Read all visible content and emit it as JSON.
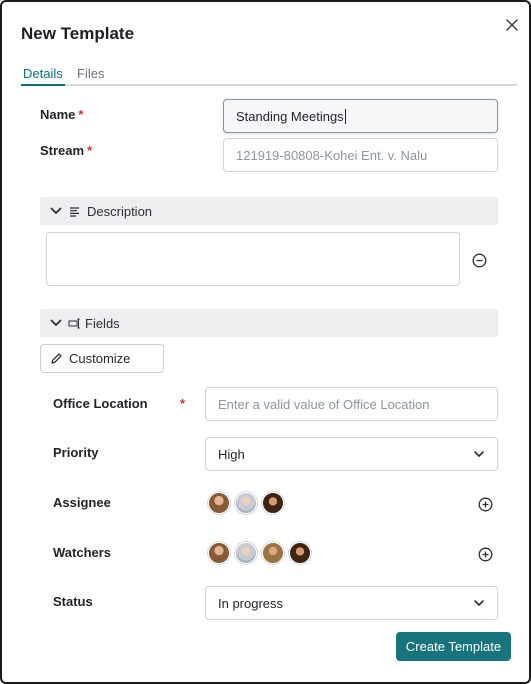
{
  "dialog": {
    "title": "New Template"
  },
  "tabs": [
    {
      "label": "Details",
      "active": true
    },
    {
      "label": "Files",
      "active": false
    }
  ],
  "form": {
    "name": {
      "label": "Name",
      "required": "*",
      "value": "Standing Meetings"
    },
    "stream": {
      "label": "Stream",
      "required": "*",
      "placeholder": "121919-80808-Kohei Ent. v. Nalu"
    }
  },
  "description_section": {
    "label": "Description",
    "value": ""
  },
  "fields_section": {
    "label": "Fields",
    "customize_label": "Customize"
  },
  "fields": {
    "office_location": {
      "label": "Office Location",
      "required": "*",
      "placeholder": "Enter a valid value of Office Location"
    },
    "priority": {
      "label": "Priority",
      "value": "High"
    },
    "assignee": {
      "label": "Assignee",
      "avatars": 3
    },
    "watchers": {
      "label": "Watchers",
      "avatars": 4
    },
    "status": {
      "label": "Status",
      "value": "In progress"
    }
  },
  "actions": {
    "create_label": "Create Template"
  },
  "colors": {
    "accent": "#17737d",
    "required": "#d0343a",
    "section_bg": "#eceef0"
  }
}
